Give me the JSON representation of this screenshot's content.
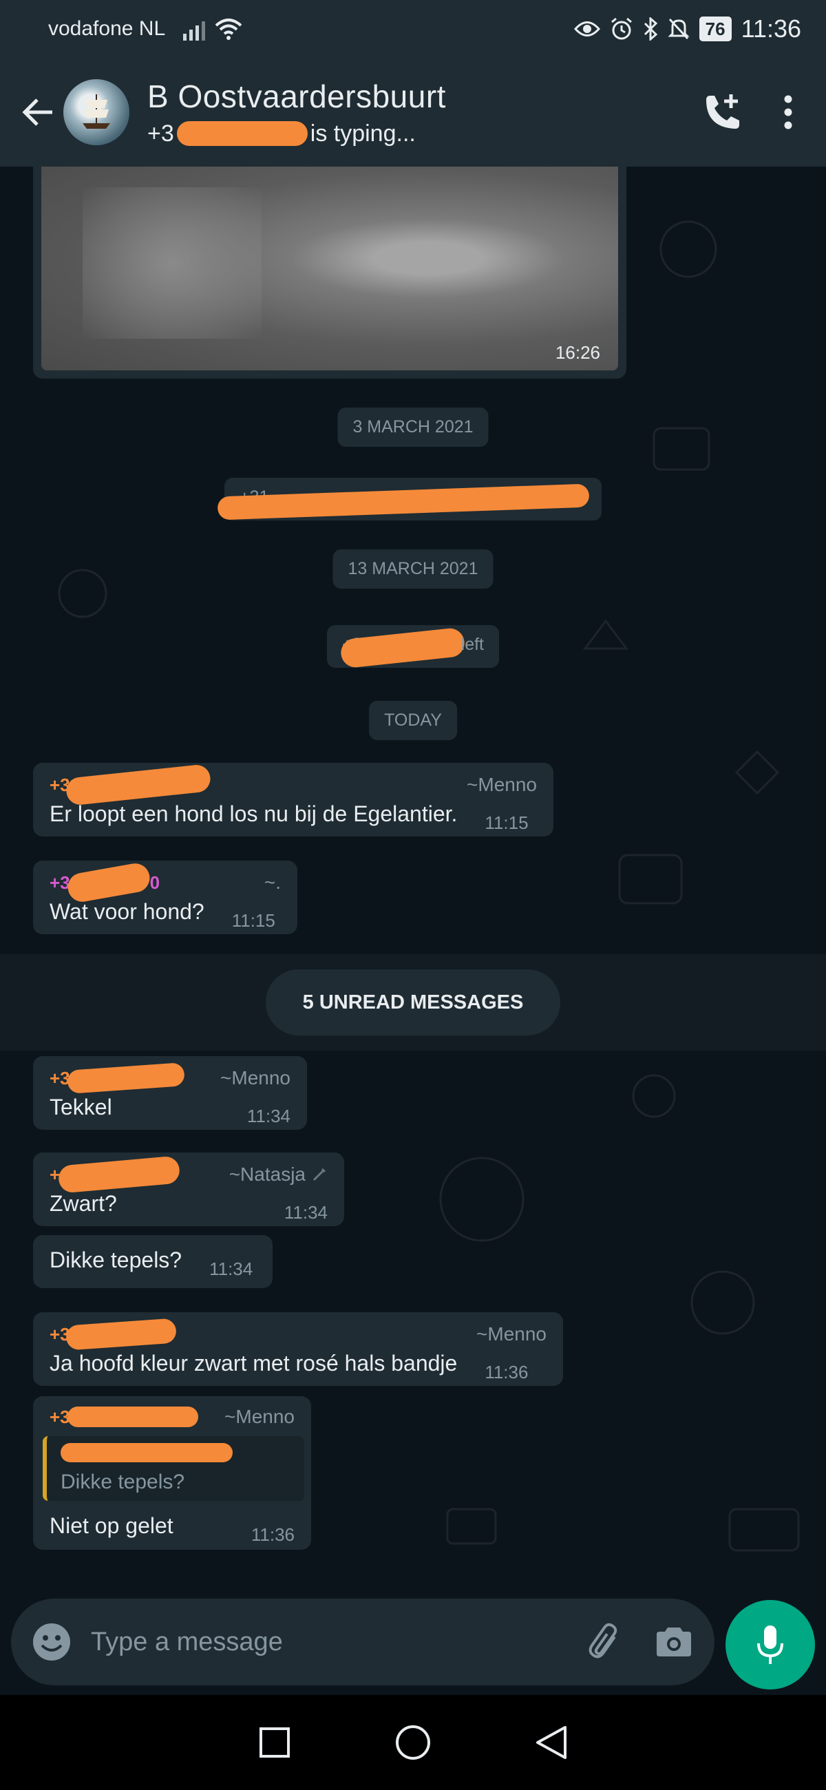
{
  "status_bar": {
    "carrier": "vodafone NL",
    "battery": "76",
    "time": "11:36"
  },
  "header": {
    "title": "B Oostvaardersbuurt",
    "subtitle_prefix": "+3",
    "subtitle_suffix": "is typing..."
  },
  "chat": {
    "image_message_time": "16:26",
    "date_1": "3 MARCH 2021",
    "system_1_prefix": "+31",
    "date_2": "13 MARCH 2021",
    "system_2_prefix": "+3",
    "system_2_suffix": "left",
    "date_3": "TODAY",
    "unread_label": "5 UNREAD MESSAGES",
    "messages": [
      {
        "phone": "+3",
        "nick": "~Menno",
        "text": "Er loopt een hond los nu bij de Egelantier.",
        "time": "11:15"
      },
      {
        "phone": "+3",
        "phone_tail": "0",
        "nick": "~.",
        "text": "Wat voor hond?",
        "time": "11:15"
      },
      {
        "phone": "+3",
        "nick": "~Menno",
        "text": "Tekkel",
        "time": "11:34"
      },
      {
        "phone": "+",
        "nick": "~Natasja",
        "text": "Zwart?",
        "time": "11:34"
      },
      {
        "text": "Dikke tepels?",
        "time": "11:34"
      },
      {
        "phone": "+3",
        "nick": "~Menno",
        "text": "Ja hoofd kleur zwart met rosé hals bandje",
        "time": "11:36"
      },
      {
        "phone": "+3",
        "nick": "~Menno",
        "quote_text": "Dikke tepels?",
        "text": "Niet op gelet",
        "time": "11:36"
      }
    ]
  },
  "input": {
    "placeholder": "Type a message"
  },
  "colors": {
    "background": "#0b141a",
    "bubble": "#1f2c33",
    "redaction": "#f58a3a",
    "accent": "#00a884"
  }
}
